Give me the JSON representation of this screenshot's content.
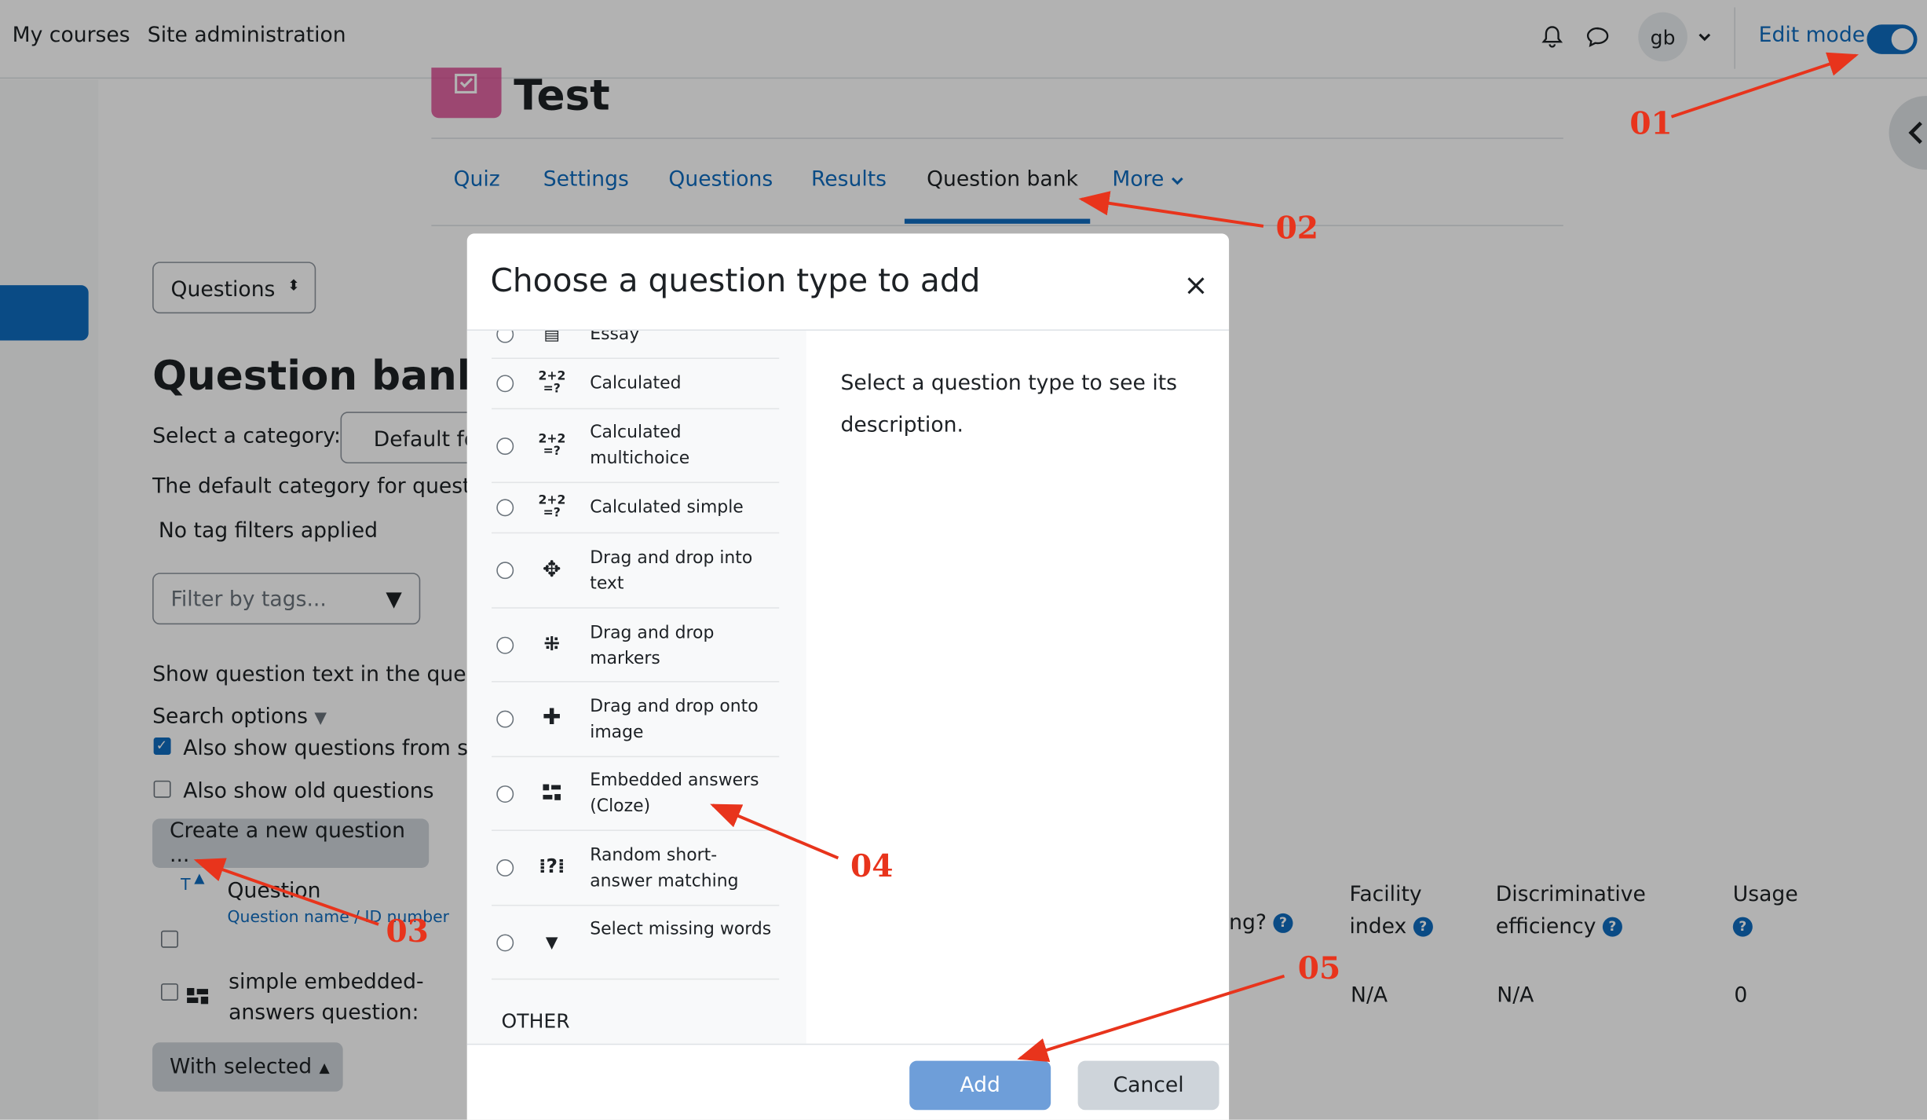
{
  "topnav": {
    "my_courses": "My courses",
    "site_admin": "Site administration",
    "avatar": "gb",
    "edit_mode": "Edit mode"
  },
  "activity": {
    "title": "Test",
    "tabs": [
      "Quiz",
      "Settings",
      "Questions",
      "Results",
      "Question bank",
      "More"
    ],
    "active_tab": "Question bank"
  },
  "qbank": {
    "nav_select": "Questions",
    "heading": "Question bank",
    "select_category_label": "Select a category:",
    "category_value": "Default fo",
    "default_category_text": "The default category for question",
    "no_tag_filters": "No tag filters applied",
    "filter_placeholder": "Filter by tags...",
    "show_question_text": "Show question text in the questi",
    "search_options": "Search options",
    "also_show_sub": "Also show questions from sub",
    "also_show_old": "Also show old questions",
    "create_button": "Create a new question ...",
    "col_t": "T",
    "col_question": "Question",
    "col_question_sub": "Question name / ID number",
    "col_needs_checking": "ng?",
    "col_facility": "Facility index",
    "col_discriminative": "Discriminative efficiency",
    "col_usage": "Usage",
    "row": {
      "name": "simple embedded-answers question:",
      "facility": "N/A",
      "discriminative": "N/A",
      "usage": "0"
    },
    "with_selected": "With selected"
  },
  "modal": {
    "title": "Choose a question type to add",
    "close": "×",
    "items": [
      {
        "label": "Essay",
        "icon": "essay-icon"
      },
      {
        "label": "Calculated",
        "icon": "calculated-icon"
      },
      {
        "label": "Calculated multichoice",
        "icon": "calculated-multichoice-icon"
      },
      {
        "label": "Calculated simple",
        "icon": "calculated-simple-icon"
      },
      {
        "label": "Drag and drop into text",
        "icon": "drag-drop-text-icon"
      },
      {
        "label": "Drag and drop markers",
        "icon": "drag-drop-markers-icon"
      },
      {
        "label": "Drag and drop onto image",
        "icon": "drag-drop-image-icon"
      },
      {
        "label": "Embedded answers (Cloze)",
        "icon": "embedded-answers-icon"
      },
      {
        "label": "Random short-answer matching",
        "icon": "random-short-answer-icon"
      },
      {
        "label": "Select missing words",
        "icon": "select-missing-words-icon"
      }
    ],
    "section_other": "OTHER",
    "description": "Select a question type to see its description.",
    "add_button": "Add",
    "cancel_button": "Cancel"
  },
  "annotations": [
    "01",
    "02",
    "03",
    "04",
    "05"
  ],
  "colors": {
    "brand": "#0f6cbf",
    "annotation": "#e8341c",
    "overlay": "rgba(0,0,0,0.3)"
  }
}
